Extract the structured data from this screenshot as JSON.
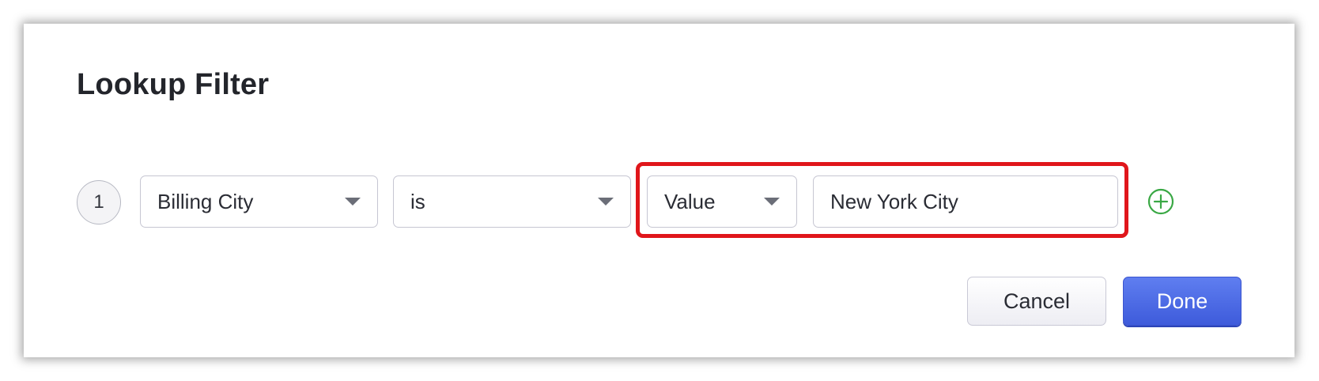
{
  "dialog": {
    "title": "Lookup Filter"
  },
  "filter_row": {
    "index": "1",
    "field": {
      "value": "Billing City"
    },
    "operator": {
      "value": "is"
    },
    "value_type": {
      "value": "Value"
    },
    "value_input": {
      "value": "New York City",
      "placeholder": ""
    },
    "add_icon": "plus-circle-icon",
    "highlight_color": "#e0161b"
  },
  "footer": {
    "cancel_label": "Cancel",
    "done_label": "Done"
  },
  "colors": {
    "primary": "#4a66e0",
    "add_icon": "#3aa845"
  }
}
